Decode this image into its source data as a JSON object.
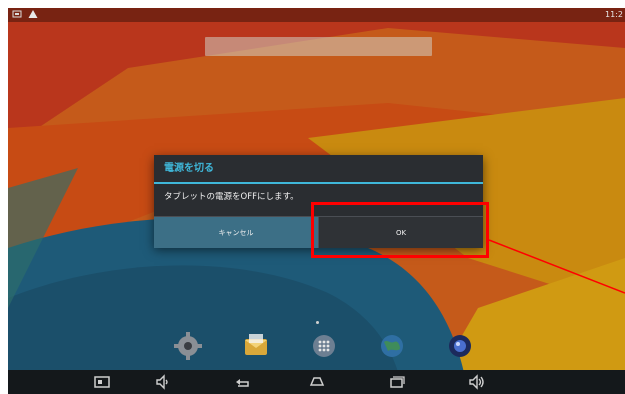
{
  "status_bar": {
    "time": "11:2",
    "icons": [
      "screenshot-icon",
      "warning-icon"
    ]
  },
  "search_bar": {
    "placeholder": ""
  },
  "dialog": {
    "title": "電源を切る",
    "message": "タブレットの電源をOFFにします。",
    "cancel_label": "キャンセル",
    "ok_label": "OK"
  },
  "dock": {
    "apps": [
      "settings-app",
      "email-app",
      "app-drawer",
      "browser-app",
      "camera-app"
    ]
  },
  "nav_bar": {
    "buttons": [
      "screenshot-button",
      "volume-down-button",
      "back-button",
      "home-button",
      "recent-apps-button",
      "volume-up-button"
    ]
  },
  "colors": {
    "accent": "#3fb7d9",
    "highlight": "#ff0000",
    "dialog_bg": "#2a2d31",
    "cancel_bg": "#3c6f86"
  }
}
